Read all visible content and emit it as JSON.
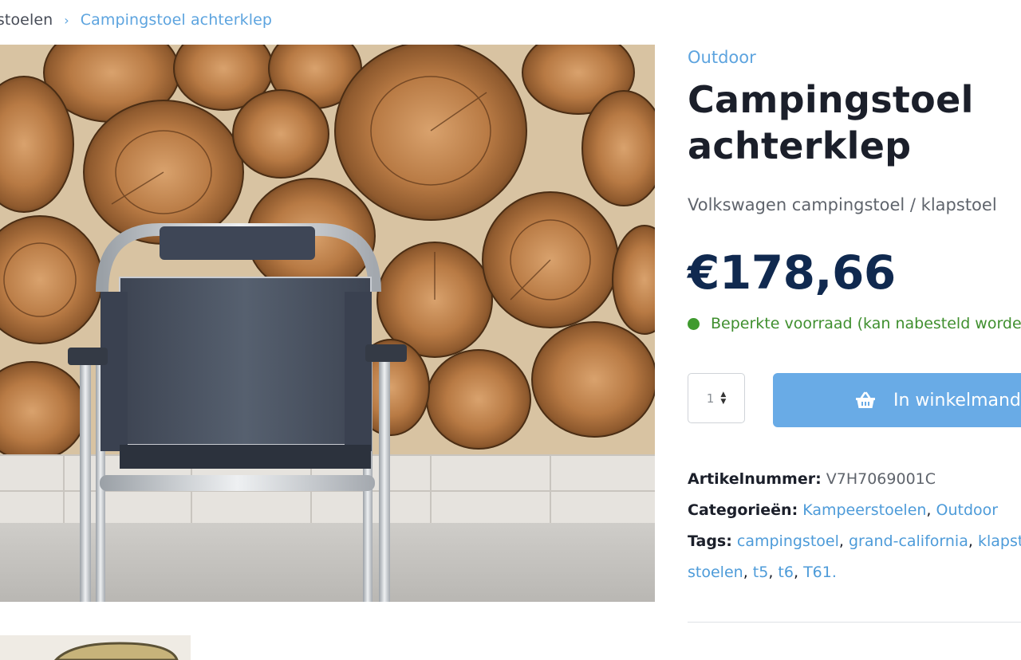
{
  "breadcrumb": {
    "previous": "rstoelen",
    "separator": "›",
    "current": "Campingstoel achterklep"
  },
  "product": {
    "category": "Outdoor",
    "title": "Campingstoel achterklep",
    "subtitle": "Volkswagen campingstoel / klapstoel",
    "price": "€178,66",
    "stock": "Beperkte voorraad (kan nabesteld worden)",
    "quantity": "1",
    "add_to_cart": "In winkelmand",
    "sku_label": "Artikelnummer:",
    "sku": "V7H7069001C",
    "categories_label": "Categorieën:",
    "categories": [
      "Kampeerstoelen",
      "Outdoor"
    ],
    "tags_label": "Tags:",
    "tags": [
      "campingstoel",
      "grand-california",
      "klapstoelen",
      "stoelen",
      "t5",
      "t6",
      "T61."
    ]
  },
  "colors": {
    "accent": "#5da4df",
    "button": "#69abe6",
    "price": "#10294f",
    "in_stock": "#3f8f2e"
  },
  "icons": {
    "cart": "basket-icon",
    "chevron": "chevron-right-icon",
    "stock": "status-dot-icon"
  }
}
